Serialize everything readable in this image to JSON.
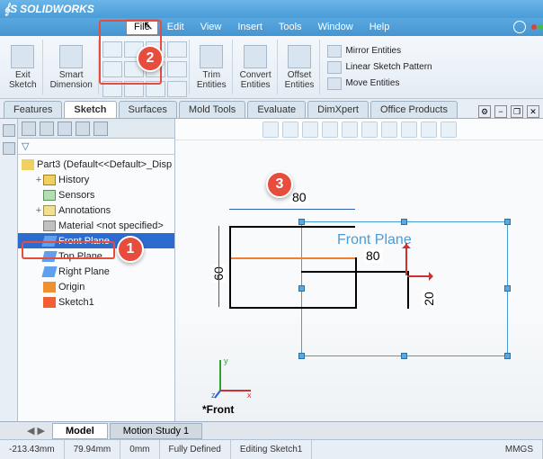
{
  "app": {
    "name": "SOLIDWORKS"
  },
  "menu": [
    "File",
    "Edit",
    "View",
    "Insert",
    "Tools",
    "Window",
    "Help"
  ],
  "ribbon": {
    "exit_sketch": "Exit\nSketch",
    "smart_dim": "Smart\nDimension",
    "trim": "Trim\nEntities",
    "convert": "Convert\nEntities",
    "offset": "Offset\nEntities",
    "mirror": "Mirror Entities",
    "linear": "Linear Sketch Pattern",
    "move": "Move Entities"
  },
  "tabs": [
    "Features",
    "Sketch",
    "Surfaces",
    "Mold Tools",
    "Evaluate",
    "DimXpert",
    "Office Products"
  ],
  "active_tab": "Sketch",
  "tree": {
    "root": "Part3 (Default<<Default>_Disp",
    "items": [
      {
        "label": "History",
        "icon": "hist"
      },
      {
        "label": "Sensors",
        "icon": "sens"
      },
      {
        "label": "Annotations",
        "icon": "anno"
      },
      {
        "label": "Material <not specified>",
        "icon": "mat"
      },
      {
        "label": "Front Plane",
        "icon": "plane",
        "selected": true
      },
      {
        "label": "Top Plane",
        "icon": "plane"
      },
      {
        "label": "Right Plane",
        "icon": "plane"
      },
      {
        "label": "Origin",
        "icon": "origin"
      },
      {
        "label": "Sketch1",
        "icon": "sketch"
      }
    ]
  },
  "viewport": {
    "plane_label": "Front Plane",
    "dims": {
      "d1": "80",
      "d2": "80",
      "d3": "60",
      "d4": "20"
    },
    "view_name": "*Front"
  },
  "bottom_tabs": [
    "Model",
    "Motion Study 1"
  ],
  "status": {
    "x": "-213.43mm",
    "y": "79.94mm",
    "z": "0mm",
    "state": "Fully Defined",
    "editing": "Editing Sketch1",
    "units": "MMGS"
  },
  "callouts": {
    "c1": "1",
    "c2": "2",
    "c3": "3"
  }
}
